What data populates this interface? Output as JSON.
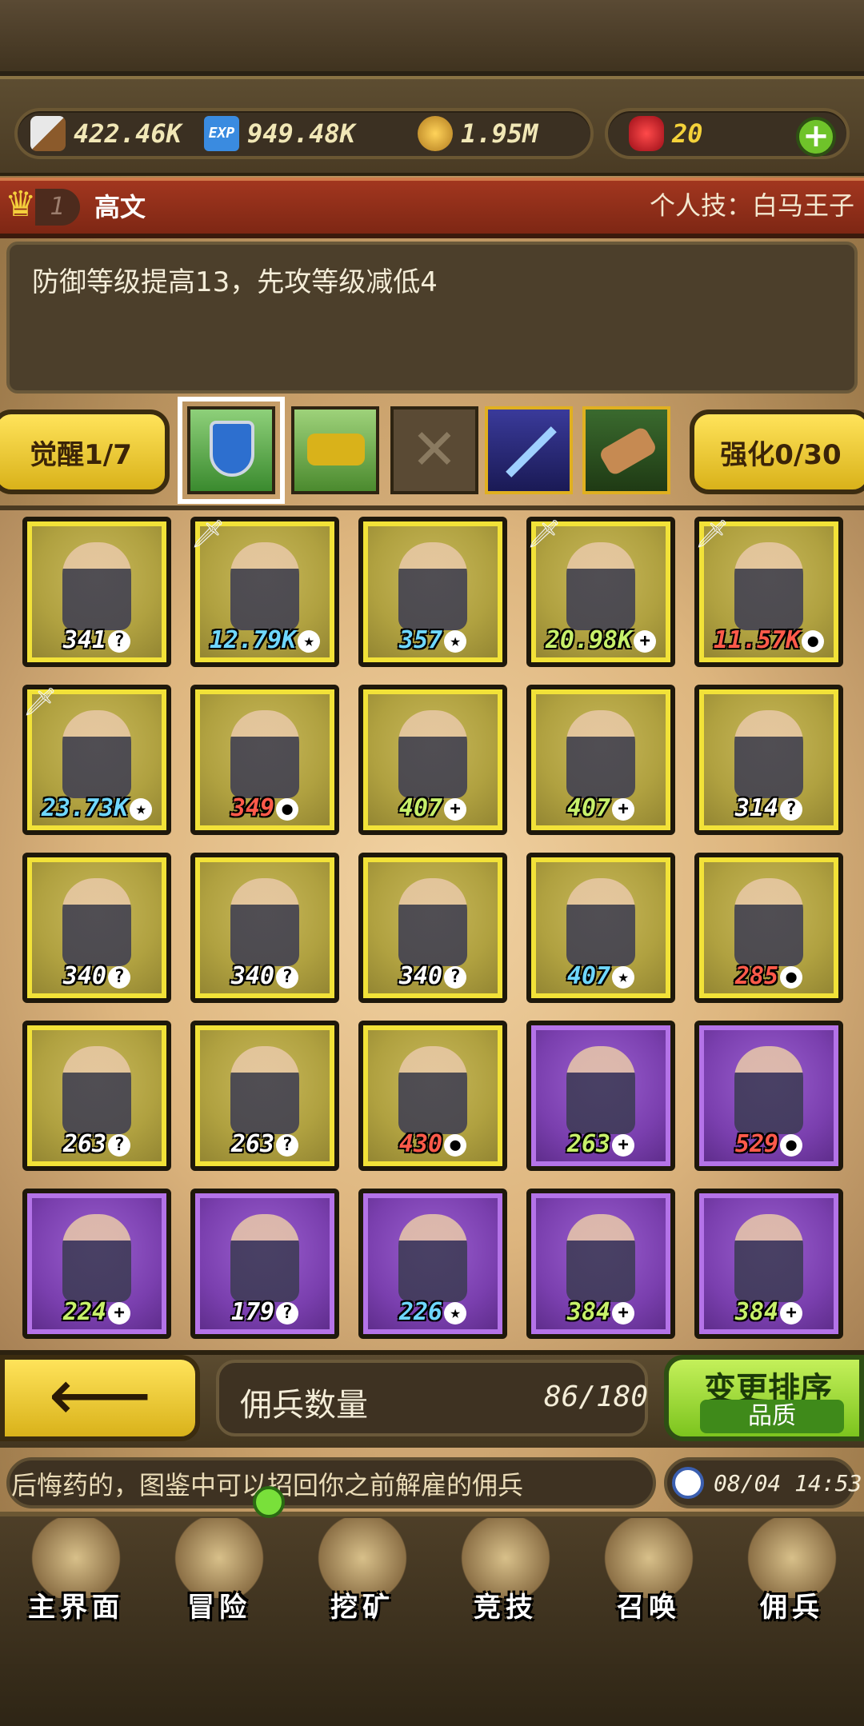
{
  "resources": {
    "attack": "422.46K",
    "exp": "949.48K",
    "gold": "1.95M",
    "gems": "20"
  },
  "hero": {
    "level": "1",
    "name": "高文",
    "skill": "个人技：白马王子",
    "description": "防御等级提高13，先攻等级减低4"
  },
  "actions": {
    "awaken": "觉醒1/7",
    "enhance": "强化0/30"
  },
  "mercenaries": [
    {
      "value": "341",
      "badge": "?",
      "color": "white",
      "frame": "y",
      "sword": false
    },
    {
      "value": "12.79K",
      "badge": "★",
      "color": "cyan",
      "frame": "y",
      "sword": true
    },
    {
      "value": "357",
      "badge": "★",
      "color": "cyan",
      "frame": "y",
      "sword": false
    },
    {
      "value": "20.98K",
      "badge": "+",
      "color": "green",
      "frame": "y",
      "sword": true
    },
    {
      "value": "11.57K",
      "badge": "●",
      "color": "red",
      "frame": "y",
      "sword": true
    },
    {
      "value": "23.73K",
      "badge": "★",
      "color": "cyan",
      "frame": "y",
      "sword": true
    },
    {
      "value": "349",
      "badge": "●",
      "color": "red",
      "frame": "y",
      "sword": false
    },
    {
      "value": "407",
      "badge": "+",
      "color": "green",
      "frame": "y",
      "sword": false
    },
    {
      "value": "407",
      "badge": "+",
      "color": "green",
      "frame": "y",
      "sword": false
    },
    {
      "value": "314",
      "badge": "?",
      "color": "white",
      "frame": "y",
      "sword": false
    },
    {
      "value": "340",
      "badge": "?",
      "color": "white",
      "frame": "y",
      "sword": false
    },
    {
      "value": "340",
      "badge": "?",
      "color": "white",
      "frame": "y",
      "sword": false
    },
    {
      "value": "340",
      "badge": "?",
      "color": "white",
      "frame": "y",
      "sword": false
    },
    {
      "value": "407",
      "badge": "★",
      "color": "cyan",
      "frame": "y",
      "sword": false
    },
    {
      "value": "285",
      "badge": "●",
      "color": "red",
      "frame": "y",
      "sword": false
    },
    {
      "value": "263",
      "badge": "?",
      "color": "white",
      "frame": "y",
      "sword": false
    },
    {
      "value": "263",
      "badge": "?",
      "color": "white",
      "frame": "y",
      "sword": false
    },
    {
      "value": "430",
      "badge": "●",
      "color": "red",
      "frame": "y",
      "sword": false
    },
    {
      "value": "263",
      "badge": "+",
      "color": "green",
      "frame": "p",
      "sword": false
    },
    {
      "value": "529",
      "badge": "●",
      "color": "red",
      "frame": "p",
      "sword": false
    },
    {
      "value": "224",
      "badge": "+",
      "color": "green",
      "frame": "p",
      "sword": false
    },
    {
      "value": "179",
      "badge": "?",
      "color": "white",
      "frame": "p",
      "sword": false
    },
    {
      "value": "226",
      "badge": "★",
      "color": "cyan",
      "frame": "p",
      "sword": false
    },
    {
      "value": "384",
      "badge": "+",
      "color": "green",
      "frame": "p",
      "sword": false
    },
    {
      "value": "384",
      "badge": "+",
      "color": "green",
      "frame": "p",
      "sword": false
    }
  ],
  "footer": {
    "count_label": "佣兵数量",
    "count_value": "86/180",
    "sort_label": "变更排序",
    "sort_mode": "品质",
    "ticker": "后悔药的，图鉴中可以招回你之前解雇的佣兵",
    "time": "08/04 14:53"
  },
  "nav": [
    {
      "label": "主界面",
      "icon": "map-scroll-icon"
    },
    {
      "label": "冒险",
      "icon": "island-icon"
    },
    {
      "label": "挖矿",
      "icon": "pickaxe-icon"
    },
    {
      "label": "竞技",
      "icon": "crossed-swords-icon"
    },
    {
      "label": "召唤",
      "icon": "summon-scroll-icon"
    },
    {
      "label": "佣兵",
      "icon": "tent-icon"
    }
  ],
  "colors": {
    "accent_yellow": "#ffe35a",
    "accent_green": "#7cc41e",
    "name_bar": "#a2361f"
  }
}
